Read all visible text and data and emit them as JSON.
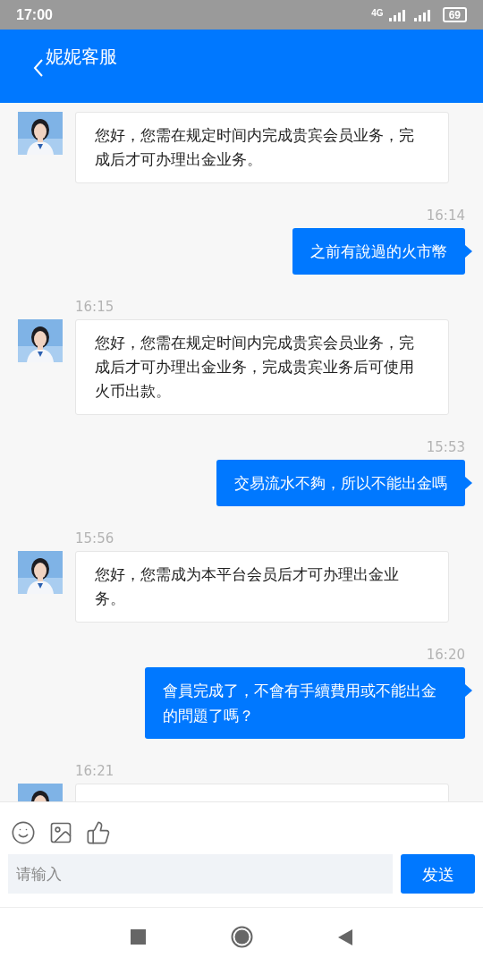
{
  "status_bar": {
    "time": "17:00",
    "network": "4G",
    "battery": "69"
  },
  "header": {
    "title": "妮妮客服"
  },
  "messages": [
    {
      "kind": "agent",
      "text": "您好，您需在规定时间内完成贵宾会员业务，完成后才可办理出金业务。"
    },
    {
      "kind": "user",
      "time": "16:14",
      "text": "之前有說過的火市幣"
    },
    {
      "kind": "agent",
      "time": "16:15",
      "text": "您好，您需在规定时间内完成贵宾会员业务，完成后才可办理出金业务，完成贵宾业务后可使用火币出款。"
    },
    {
      "kind": "user",
      "time": "15:53",
      "text": "交易流水不夠，所以不能出金嗎"
    },
    {
      "kind": "agent",
      "time": "15:56",
      "text": "您好，您需成为本平台会员后才可办理出金业务。"
    },
    {
      "kind": "user",
      "time": "16:20",
      "text": "會員完成了，不會有手續費用或不能出金的問題了嗎？"
    },
    {
      "kind": "agent",
      "time": "16:21"
    }
  ],
  "composer": {
    "placeholder": "请输入",
    "send": "发送"
  }
}
